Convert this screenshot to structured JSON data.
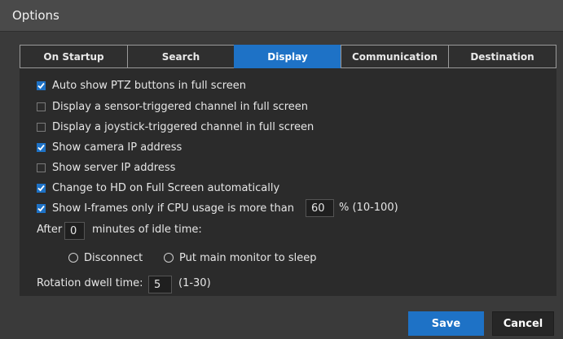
{
  "dialog": {
    "title": "Options"
  },
  "tabs": [
    {
      "label": "On Startup",
      "active": false
    },
    {
      "label": "Search",
      "active": false
    },
    {
      "label": "Display",
      "active": true
    },
    {
      "label": "Communication",
      "active": false
    },
    {
      "label": "Destination",
      "active": false
    }
  ],
  "options": [
    {
      "label": "Auto show PTZ buttons in full screen",
      "checked": true
    },
    {
      "label": "Display a sensor-triggered channel in full screen",
      "checked": false
    },
    {
      "label": "Display a joystick-triggered channel in full screen",
      "checked": false
    },
    {
      "label": "Show camera IP address",
      "checked": true
    },
    {
      "label": "Show server IP address",
      "checked": false
    },
    {
      "label": "Change to HD on Full Screen automatically",
      "checked": true
    }
  ],
  "iframes": {
    "label": "Show I-frames only if CPU usage is more than",
    "checked": true,
    "value": "60",
    "range": "% (10-100)"
  },
  "idle": {
    "before": "After",
    "value": "0",
    "after": "minutes of idle time:",
    "radio_disconnect": "Disconnect",
    "radio_sleep": "Put main monitor to sleep"
  },
  "dwell": {
    "label": "Rotation dwell time:",
    "value": "5",
    "range": "(1-30)"
  },
  "buttons": {
    "save": "Save",
    "cancel": "Cancel"
  },
  "colors": {
    "accent": "#1e72c6",
    "background": "#3a3a3a",
    "panel": "#2b2b2b"
  }
}
